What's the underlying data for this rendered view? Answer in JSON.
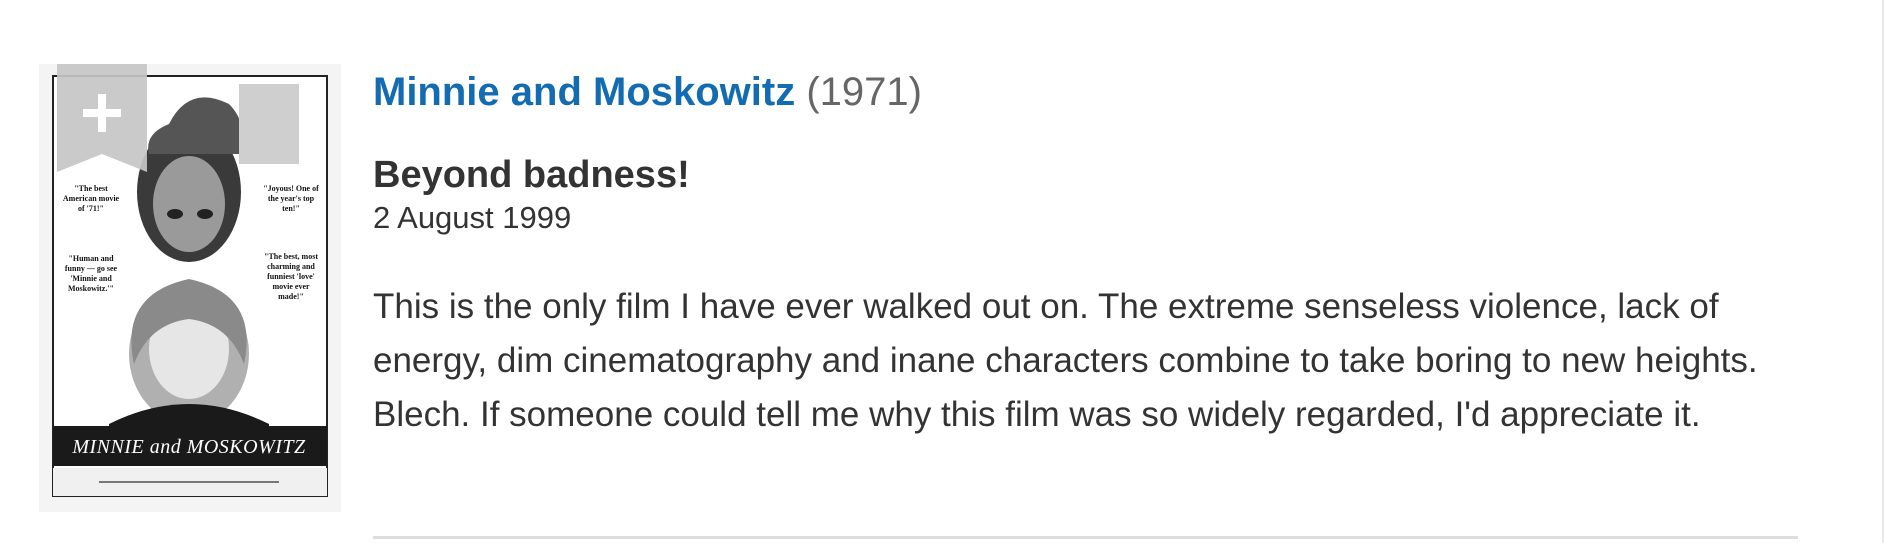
{
  "movie": {
    "title": "Minnie and Moskowitz",
    "year": "(1971)",
    "poster": {
      "alt": "Minnie and Moskowitz poster",
      "title_text": "MINNIE and MOSKOWITZ",
      "quotes": [
        "\"The best American movie of '71!\"",
        "\"Joyous! One of the year's top ten!\"",
        "\"Human and funny — go see 'Minnie and Moskowitz.'\"",
        "\"The best, most charming and funniest 'love' movie ever made!\""
      ]
    },
    "watchlist_label": "+"
  },
  "review": {
    "title": "Beyond badness!",
    "date": "2 August 1999",
    "text": "This is the only film I have ever walked out on. The extreme senseless violence, lack of energy, dim cinematography and inane characters combine to take boring to new heights. Blech. If someone could tell me why this film was so widely regarded, I'd appreciate it."
  },
  "colors": {
    "link": "#136cb2",
    "text": "#333333",
    "year": "#666666",
    "ribbon": "#c5c5c5"
  }
}
